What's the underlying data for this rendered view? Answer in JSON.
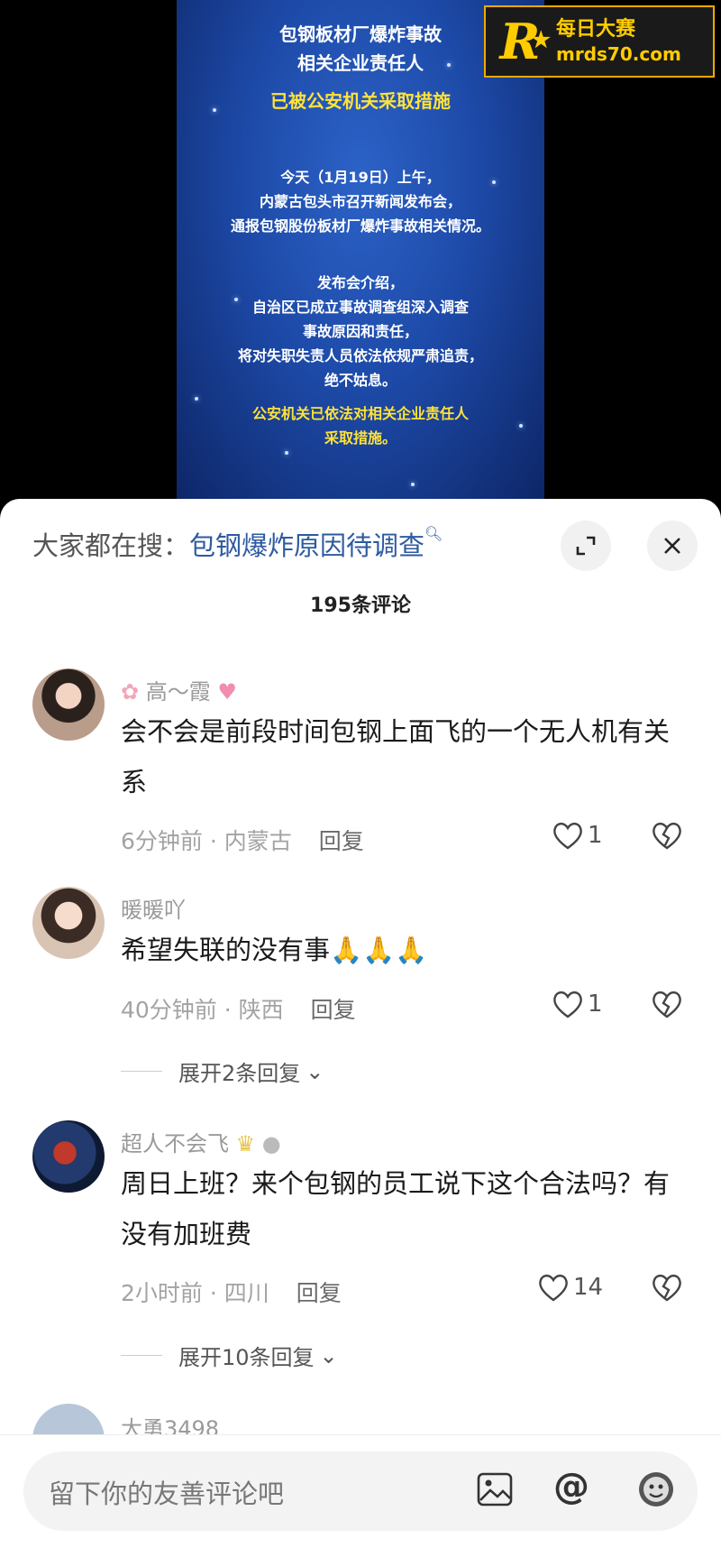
{
  "video": {
    "title_line1": "包钢板材厂爆炸事故",
    "title_line2": "相关企业责任人",
    "title_line3": "已被公安机关采取措施",
    "body": [
      "今天（1月19日）上午，",
      "内蒙古包头市召开新闻发布会，",
      "通报包钢股份板材厂爆炸事故相关情况。",
      "",
      "发布会介绍，",
      "自治区已成立事故调查组深入调查",
      "事故原因和责任，",
      "将对失职失责人员依法依规严肃追责，",
      "绝不姑息。"
    ],
    "highlight": [
      "公安机关已依法对相关企业责任人",
      "采取措施。"
    ]
  },
  "watermark": {
    "mark": "R",
    "title": "每日大赛",
    "site": "mrds70.com"
  },
  "sheet": {
    "search_prefix": "大家都在搜：",
    "search_keyword": "包钢爆炸原因待调查",
    "comment_count": "195条评论"
  },
  "comments": [
    {
      "user": "高～霞",
      "text": "会不会是前段时间包钢上面飞的一个无人机有关系",
      "time": "6分钟前 · 内蒙古",
      "reply": "回复",
      "likes": "1"
    },
    {
      "user": "暖暖吖",
      "text": "希望失联的没有事🙏🙏🙏",
      "time": "40分钟前 · 陕西",
      "reply": "回复",
      "likes": "1",
      "expand": "展开2条回复"
    },
    {
      "user": "超人不会飞",
      "text": "周日上班？来个包钢的员工说下这个合法吗？有没有加班费",
      "time": "2小时前 · 四川",
      "reply": "回复",
      "likes": "14",
      "expand": "展开10条回复"
    },
    {
      "user": "大勇3498"
    }
  ],
  "input": {
    "placeholder": "留下你的友善评论吧"
  },
  "colors": {
    "keyword": "#2d5aa0",
    "highlight": "#ffe23a",
    "video_bg": "#1d4aa8"
  }
}
